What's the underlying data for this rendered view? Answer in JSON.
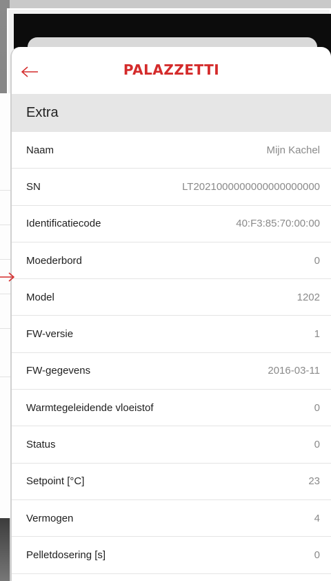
{
  "brand": {
    "logo_text": "PALAZZETTI",
    "color": "#d42b2b"
  },
  "header": {
    "back_icon": "arrow-left-icon"
  },
  "section": {
    "title": "Extra"
  },
  "rows": [
    {
      "label": "Naam",
      "value": "Mijn Kachel"
    },
    {
      "label": "SN",
      "value": "LT2021000000000000000000"
    },
    {
      "label": "Identificatiecode",
      "value": "40:F3:85:70:00:00"
    },
    {
      "label": "Moederbord",
      "value": "0"
    },
    {
      "label": "Model",
      "value": "1202"
    },
    {
      "label": "FW-versie",
      "value": "1"
    },
    {
      "label": "FW-gegevens",
      "value": "2016-03-11"
    },
    {
      "label": "Warmtegeleidende vloeistof",
      "value": "0"
    },
    {
      "label": "Status",
      "value": "0"
    },
    {
      "label": "Setpoint [°C]",
      "value": "23"
    },
    {
      "label": "Vermogen",
      "value": "4"
    },
    {
      "label": "Pelletdosering [s]",
      "value": "0"
    }
  ]
}
